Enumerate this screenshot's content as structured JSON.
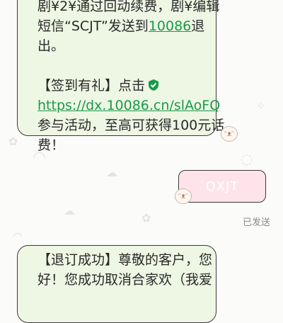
{
  "message_1": {
    "lines": [
      "剧¥2¥通过回动续费，剧¥编辑",
      "短信“SCJT”发送到10086退",
      "出。",
      "",
      "【签到有礼】点击",
      "https://dx.10086.cn/slAoFQ",
      "参与活动，至高可获得100元话",
      "费！"
    ],
    "line2_prefix": "短信“SCJT”发送到",
    "phone_link": "10086",
    "line2_suffix": "退",
    "link_url": "https://dx.10086.cn/slAoFQ",
    "link_color": "#1a9a4a"
  },
  "message_2": {
    "text": "QXJT",
    "bubble_color": "#ffe3ea",
    "status": "已发送"
  },
  "message_3": {
    "line1": "【退订成功】尊敬的客户，您",
    "line2": "好！您成功取消合家欢（我爱"
  },
  "icons": {
    "shield": "shield-check-icon",
    "sticker": "bunny-sticker-icon"
  }
}
